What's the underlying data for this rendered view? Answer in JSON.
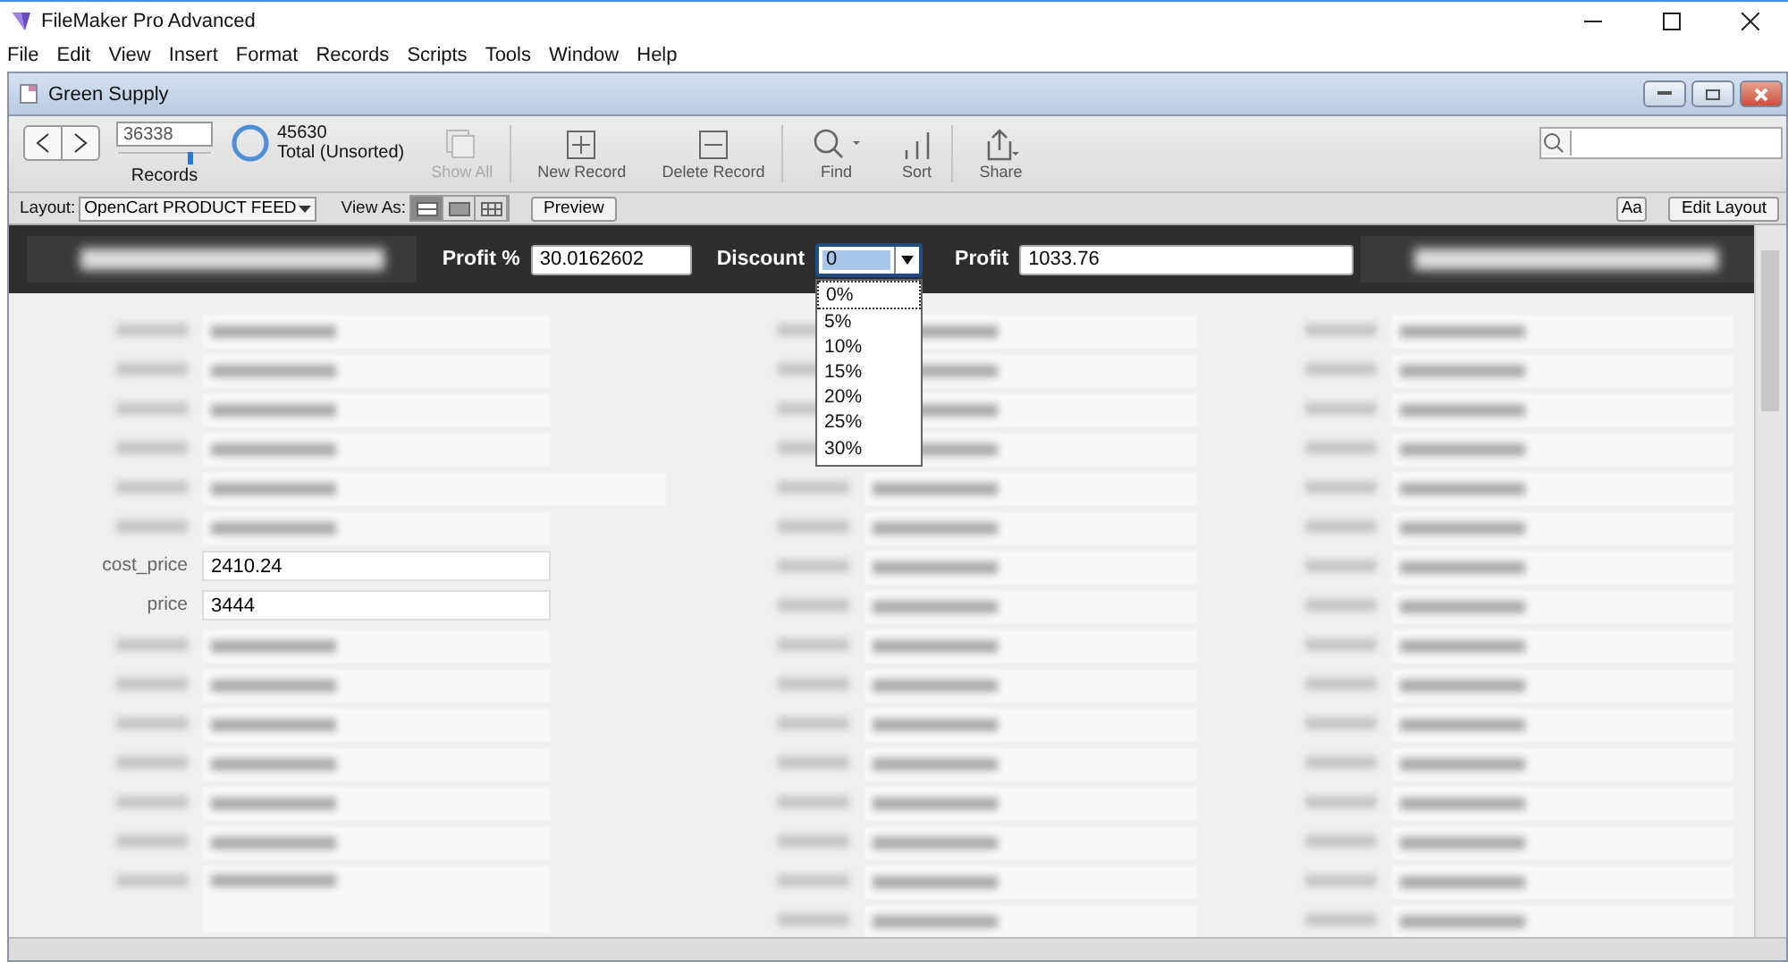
{
  "app_window": {
    "title": "FileMaker Pro Advanced"
  },
  "menu": [
    "File",
    "Edit",
    "View",
    "Insert",
    "Format",
    "Records",
    "Scripts",
    "Tools",
    "Window",
    "Help"
  ],
  "document_window": {
    "title": "Green Supply"
  },
  "toolbar": {
    "record_number": "36338",
    "records_label": "Records",
    "record_slider": {
      "level": 0.79
    },
    "found_count": "45630",
    "found_status": "Total (Unsorted)",
    "buttons": [
      {
        "kind": "show_all",
        "label": "Show All",
        "disabled": true
      },
      {
        "kind": "new",
        "label": "New Record",
        "disabled": false
      },
      {
        "kind": "delete",
        "label": "Delete Record",
        "disabled": false
      },
      {
        "kind": "find",
        "label": "Find",
        "disabled": false
      },
      {
        "kind": "sort",
        "label": "Sort",
        "disabled": false
      },
      {
        "kind": "share",
        "label": "Share",
        "disabled": false
      }
    ]
  },
  "layout_bar": {
    "layout_label": "Layout:",
    "layout_value": "OpenCart PRODUCT FEED",
    "view_as_label": "View As:",
    "view_modes": [
      {
        "kind": "form",
        "selected": true
      },
      {
        "kind": "list",
        "selected": false
      },
      {
        "kind": "table",
        "selected": false
      }
    ],
    "preview_button": "Preview",
    "format_button": "Aa",
    "edit_layout_button": "Edit Layout"
  },
  "header": {
    "profit_pct_label": "Profit %",
    "profit_pct_value": "30.0162602",
    "discount_label": "Discount",
    "discount_value": "0",
    "profit_label": "Profit",
    "profit_value": "1033.76",
    "discount_options": [
      {
        "label": "0%",
        "selected": true
      },
      {
        "label": "5%",
        "selected": false
      },
      {
        "label": "10%",
        "selected": false
      },
      {
        "label": "15%",
        "selected": false
      },
      {
        "label": "20%",
        "selected": false
      },
      {
        "label": "25%",
        "selected": false
      },
      {
        "label": "30%",
        "selected": false
      }
    ]
  },
  "columns": [
    {
      "rows": [
        {
          "kind": "blurred"
        },
        {
          "kind": "blurred"
        },
        {
          "kind": "blurred"
        },
        {
          "kind": "blurred"
        },
        {
          "kind": "blurred_wide"
        },
        {
          "kind": "blurred"
        },
        {
          "kind": "field",
          "label": "cost_price",
          "value": "2410.24"
        },
        {
          "kind": "field",
          "label": "price",
          "value": "3444"
        },
        {
          "kind": "blurred"
        },
        {
          "kind": "blurred"
        },
        {
          "kind": "blurred"
        },
        {
          "kind": "blurred"
        },
        {
          "kind": "blurred"
        },
        {
          "kind": "blurred"
        },
        {
          "kind": "blurred_tall"
        }
      ]
    },
    {
      "rows": [
        {
          "kind": "blurred"
        },
        {
          "kind": "blurred"
        },
        {
          "kind": "blurred"
        },
        {
          "kind": "blurred"
        },
        {
          "kind": "blurred"
        },
        {
          "kind": "blurred"
        },
        {
          "kind": "blurred"
        },
        {
          "kind": "blurred"
        },
        {
          "kind": "blurred"
        },
        {
          "kind": "blurred"
        },
        {
          "kind": "blurred"
        },
        {
          "kind": "blurred"
        },
        {
          "kind": "blurred"
        },
        {
          "kind": "blurred"
        },
        {
          "kind": "blurred"
        },
        {
          "kind": "blurred"
        }
      ]
    },
    {
      "rows": [
        {
          "kind": "blurred"
        },
        {
          "kind": "blurred"
        },
        {
          "kind": "blurred"
        },
        {
          "kind": "blurred"
        },
        {
          "kind": "blurred"
        },
        {
          "kind": "blurred"
        },
        {
          "kind": "blurred"
        },
        {
          "kind": "blurred"
        },
        {
          "kind": "blurred"
        },
        {
          "kind": "blurred"
        },
        {
          "kind": "blurred"
        },
        {
          "kind": "blurred"
        },
        {
          "kind": "blurred"
        },
        {
          "kind": "blurred"
        },
        {
          "kind": "blurred"
        },
        {
          "kind": "blurred"
        }
      ]
    }
  ]
}
